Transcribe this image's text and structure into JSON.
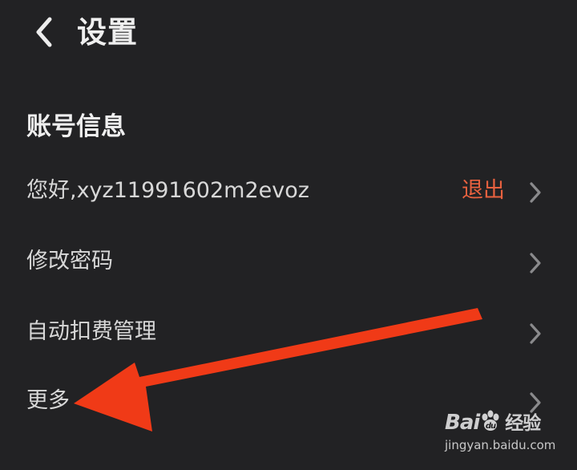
{
  "header": {
    "back_icon": "chevron-left-icon",
    "title": "设置"
  },
  "account_section": {
    "title": "账号信息",
    "rows": [
      {
        "label": "您好,xyz11991602m2evoz",
        "action": "退出",
        "icon": "chevron-right-icon"
      },
      {
        "label": "修改密码",
        "icon": "chevron-right-icon"
      },
      {
        "label": "自动扣费管理",
        "icon": "chevron-right-icon"
      },
      {
        "label": "更多",
        "icon": "chevron-right-icon"
      }
    ]
  },
  "annotation": {
    "type": "red-arrow-pointing-left",
    "color": "#f03a17",
    "target": "更多"
  },
  "watermark": {
    "logo_text_1": "Bai",
    "logo_text_2": "经验",
    "domain": "jingyan.baidu.com"
  },
  "colors": {
    "background": "#222224",
    "text": "#d8d8d8",
    "accent": "#e8613f",
    "chevron": "#8a8a8c"
  }
}
